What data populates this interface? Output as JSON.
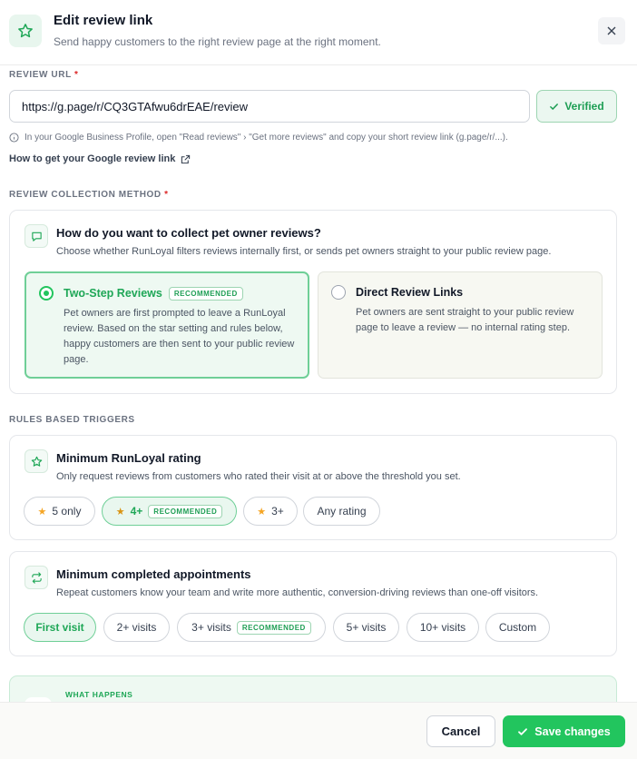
{
  "header": {
    "icon": "star-icon",
    "title": "Edit review link",
    "subtitle": "Send happy customers to the right review page at the right moment.",
    "close_icon": "close-icon"
  },
  "review_url": {
    "label": "REVIEW URL",
    "required_mark": "*",
    "value": "https://g.page/r/CQ3GTAfwu6drEAE/review",
    "verified_label": "Verified",
    "hint": "In your Google Business Profile, open \"Read reviews\" › \"Get more reviews\" and copy your short review link (g.page/r/...).",
    "help_link": "How to get your Google review link"
  },
  "collection_method": {
    "label": "REVIEW COLLECTION METHOD",
    "required_mark": "*",
    "title": "How do you want to collect pet owner reviews?",
    "description": "Choose whether RunLoyal filters reviews internally first, or sends pet owners straight to your public review page.",
    "options": [
      {
        "title": "Two-Step Reviews",
        "badge": "RECOMMENDED",
        "description": "Pet owners are first prompted to leave a RunLoyal review. Based on the star setting and rules below, happy customers are then sent to your public review page.",
        "selected": true
      },
      {
        "title": "Direct Review Links",
        "description": "Pet owners are sent straight to your public review page to leave a review — no internal rating step.",
        "selected": false
      }
    ]
  },
  "rules": {
    "label": "RULES BASED TRIGGERS",
    "rating": {
      "title": "Minimum RunLoyal rating",
      "description": "Only request reviews from customers who rated their visit at or above the threshold you set.",
      "chips": [
        {
          "label": "5 only",
          "star": "★"
        },
        {
          "label": "4+",
          "star": "★",
          "badge": "RECOMMENDED",
          "active": true
        },
        {
          "label": "3+",
          "star": "★"
        },
        {
          "label": "Any rating"
        }
      ]
    },
    "appointments": {
      "title": "Minimum completed appointments",
      "description": "Repeat customers know your team and write more authentic, conversion-driving reviews than one-off visitors.",
      "chips": [
        {
          "label": "First visit",
          "active": true
        },
        {
          "label": "2+ visits"
        },
        {
          "label": "3+ visits",
          "badge": "RECOMMENDED"
        },
        {
          "label": "5+ visits"
        },
        {
          "label": "10+ visits"
        },
        {
          "label": "Custom"
        }
      ]
    }
  },
  "what_happens": {
    "label": "WHAT HAPPENS"
  },
  "footer": {
    "cancel_label": "Cancel",
    "save_label": "Save changes"
  },
  "colors": {
    "accent": "#22c55e",
    "accent_text": "#1fa757",
    "required": "#dc2626",
    "star": "#f5a524"
  }
}
